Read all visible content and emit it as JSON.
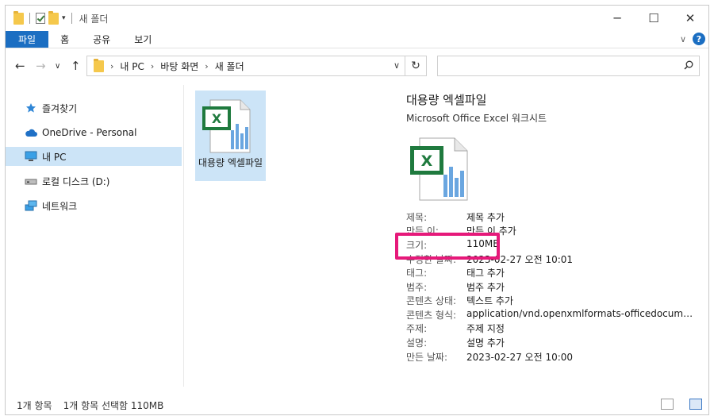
{
  "window": {
    "title": "새 폴더",
    "controls": {
      "minimize": "─",
      "maximize": "☐",
      "close": "✕"
    }
  },
  "ribbon": {
    "tabs": [
      "파일",
      "홈",
      "공유",
      "보기"
    ],
    "expand_icon": "chevron-down",
    "help_label": "?"
  },
  "address": {
    "crumbs": [
      "내 PC",
      "바탕 화면",
      "새 폴더"
    ],
    "separator": "›",
    "search_placeholder": ""
  },
  "nav": {
    "items": [
      {
        "label": "즐겨찾기",
        "icon": "star-icon"
      },
      {
        "label": "OneDrive - Personal",
        "icon": "cloud-icon"
      },
      {
        "label": "내 PC",
        "icon": "computer-icon",
        "selected": true
      },
      {
        "label": "로컬 디스크 (D:)",
        "icon": "drive-icon"
      },
      {
        "label": "네트워크",
        "icon": "network-icon"
      }
    ]
  },
  "content": {
    "file": {
      "name": "대용량 엑셀파일",
      "icon": "excel-file-icon"
    }
  },
  "preview": {
    "name": "대용량 엑셀파일",
    "type": "Microsoft Office Excel 워크시트",
    "properties": [
      {
        "key": "제목:",
        "value": "제목 추가"
      },
      {
        "key": "만든 이:",
        "value": "만든 이 추가"
      },
      {
        "key": "크기:",
        "value": "110MB"
      },
      {
        "key": "수정한 날짜:",
        "value": "2023-02-27 오전 10:01"
      },
      {
        "key": "태그:",
        "value": "태그 추가"
      },
      {
        "key": "범주:",
        "value": "범주 추가"
      },
      {
        "key": "콘텐츠 상태:",
        "value": "텍스트 추가"
      },
      {
        "key": "콘텐츠 형식:",
        "value": "application/vnd.openxmlformats-officedocument.sp..."
      },
      {
        "key": "주제:",
        "value": "주제 지정"
      },
      {
        "key": "설명:",
        "value": "설명 추가"
      },
      {
        "key": "만든 날짜:",
        "value": "2023-02-27 오전 10:00"
      }
    ],
    "highlighted_property": "크기:"
  },
  "status": {
    "item_count": "1개 항목",
    "selection": "1개 항목 선택함 110MB"
  },
  "colors": {
    "accent": "#1b6ec2",
    "selection": "#cce4f7",
    "highlight_box": "#e6197a",
    "excel_green": "#1f7a3e"
  }
}
